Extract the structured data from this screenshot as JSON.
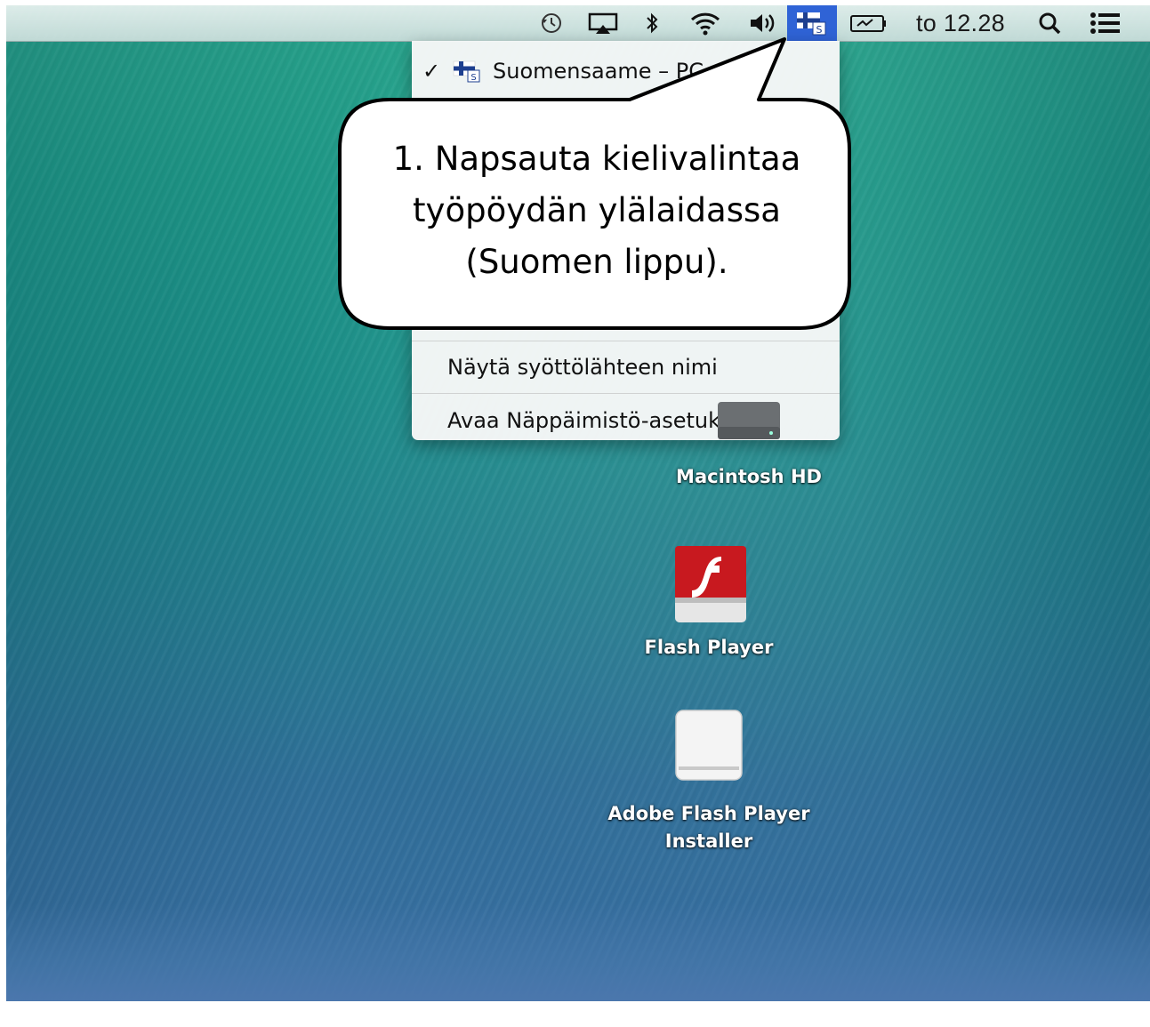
{
  "menubar": {
    "icons": [
      "time-machine-icon",
      "airplay-icon",
      "bluetooth-icon",
      "wifi-icon",
      "volume-icon",
      "input-source-flag-icon",
      "battery-icon",
      "spotlight-search-icon",
      "notification-center-icon"
    ],
    "clock": "to 12.28"
  },
  "input_menu": {
    "items": [
      {
        "label": "Suomensaame – PC",
        "checked": true,
        "icon": "finnish-flag-icon"
      },
      {
        "label": "Näytä syöttölähteen nimi",
        "checked": false
      },
      {
        "label": "Avaa Näppäimistö-asetukset…",
        "checked": false
      }
    ]
  },
  "desktop": {
    "icons": [
      {
        "label": "Macintosh HD",
        "icon": "hard-drive-icon"
      },
      {
        "label": "Flash Player",
        "icon": "flash-player-icon"
      },
      {
        "label_line1": "Adobe Flash Player",
        "label_line2": "Installer",
        "icon": "removable-disk-icon"
      }
    ]
  },
  "callout": {
    "line1": "1. Napsauta kielivalintaa",
    "line2": "työpöydän ylälaidassa",
    "line3": "(Suomen lippu)."
  },
  "colors": {
    "menubar_highlight": "#2f63d6",
    "flash_red": "#c8191f",
    "flag_blue": "#1d3f8f"
  }
}
